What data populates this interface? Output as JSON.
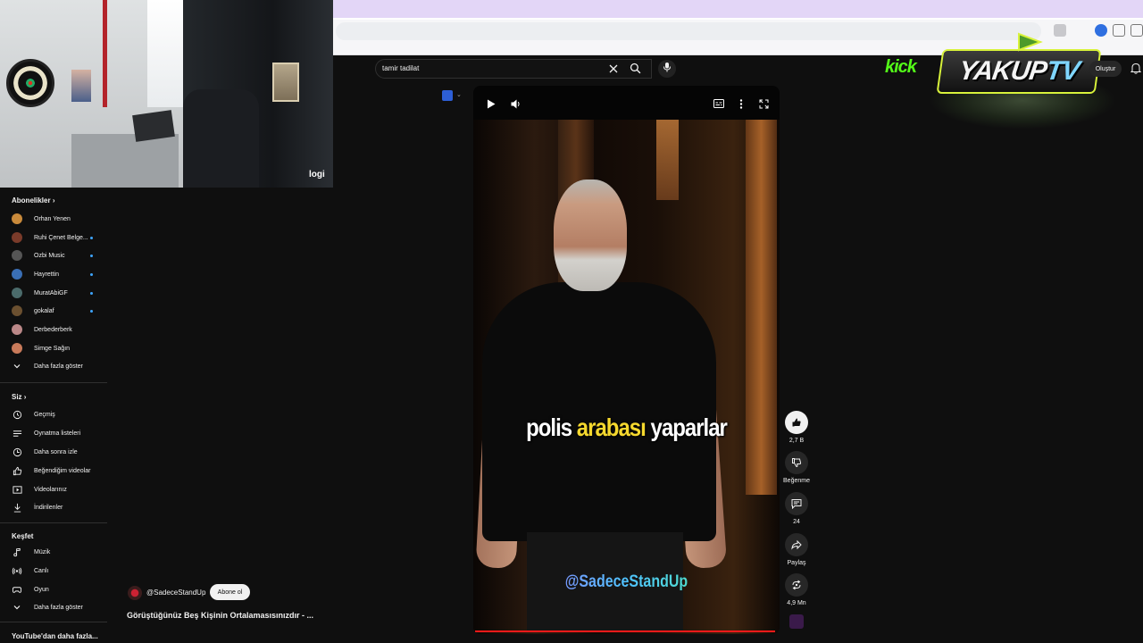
{
  "webcam": {
    "brand": "logi"
  },
  "sidebar": {
    "subscriptions_header": "Abonelikler",
    "subscriptions": [
      {
        "label": "Orhan Yenen",
        "color": "#c98a3b",
        "dot": false
      },
      {
        "label": "Ruhi Çenet Belge...",
        "color": "#7a3b2a",
        "dot": true
      },
      {
        "label": "Ozbi Music",
        "color": "#555555",
        "dot": true
      },
      {
        "label": "Hayrettin",
        "color": "#3a6fb5",
        "dot": true
      },
      {
        "label": "MuratAbiGF",
        "color": "#4b6b6b",
        "dot": true
      },
      {
        "label": "gokalaf",
        "color": "#6b5030",
        "dot": true
      },
      {
        "label": "Derbederberk",
        "color": "#b88",
        "dot": false
      },
      {
        "label": "Simge Sağın",
        "color": "#c87a5a",
        "dot": false
      }
    ],
    "show_more": "Daha fazla göster",
    "you_header": "Siz",
    "you_items": [
      {
        "label": "Geçmiş",
        "icon": "history-icon"
      },
      {
        "label": "Oynatma listeleri",
        "icon": "playlist-icon"
      },
      {
        "label": "Daha sonra izle",
        "icon": "clock-icon"
      },
      {
        "label": "Beğendiğim videolar",
        "icon": "thumbs-up-icon"
      },
      {
        "label": "Videolarınız",
        "icon": "video-icon"
      },
      {
        "label": "İndirilenler",
        "icon": "download-icon"
      }
    ],
    "explore_header": "Keşfet",
    "explore_items": [
      {
        "label": "Müzik",
        "icon": "music-icon"
      },
      {
        "label": "Canlı",
        "icon": "live-icon"
      },
      {
        "label": "Oyun",
        "icon": "gaming-icon"
      },
      {
        "label": "Daha fazla göster",
        "icon": "chevron-down-icon"
      }
    ],
    "more_from_youtube": "YouTube'dan daha fazla..."
  },
  "search": {
    "query": "tamir tadilat"
  },
  "video": {
    "caption_pre": "polis",
    "caption_highlight": "arabası",
    "caption_post": "yaparlar",
    "watermark": "@SadeceStandUp",
    "progress_fraction": 0.99
  },
  "actions": {
    "likes": "2,7 B",
    "dislike_label": "Beğenme",
    "comments": "24",
    "share_label": "Paylaş",
    "remix_count": "4,9 Mn"
  },
  "channel": {
    "handle": "@SadeceStandUp",
    "subscribe_label": "Abone ol",
    "video_title": "Görüştüğünüz Beş Kişinin Ortalamasısınızdır - ..."
  },
  "overlay": {
    "kick": "kick",
    "yakup": "YAKUP",
    "tv": "TV"
  },
  "header": {
    "create_label": "Oluştur"
  },
  "colors": {
    "accent": "#3ea6ff",
    "kick": "#53fc18",
    "highlight": "#f5d82e",
    "progress": "#ff1a1a"
  }
}
